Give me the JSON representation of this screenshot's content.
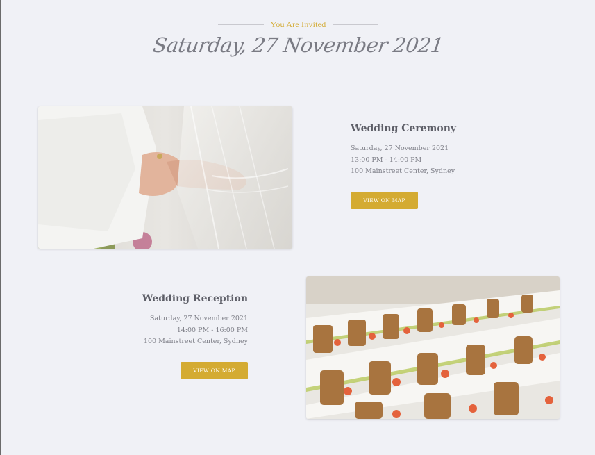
{
  "header": {
    "invite_label": "You Are Invited",
    "date_title": "Saturday, 27 November 2021"
  },
  "ceremony": {
    "title": "Wedding Ceremony",
    "date": "Saturday, 27 November 2021",
    "time": "13:00 PM - 14:00 PM",
    "location": "100 Mainstreet Center, Sydney",
    "button_label": "VIEW ON MAP",
    "photo_alt": "hands-photo"
  },
  "reception": {
    "title": "Wedding Reception",
    "date": "Saturday, 27 November 2021",
    "time": "14:00 PM - 16:00 PM",
    "location": "100 Mainstreet Center, Sydney",
    "button_label": "VIEW ON MAP",
    "photo_alt": "banquet-tables-photo"
  },
  "colors": {
    "accent": "#d4ab32",
    "background": "#f0f1f6",
    "heading": "#5d5e67",
    "body_text": "#7f8089"
  }
}
